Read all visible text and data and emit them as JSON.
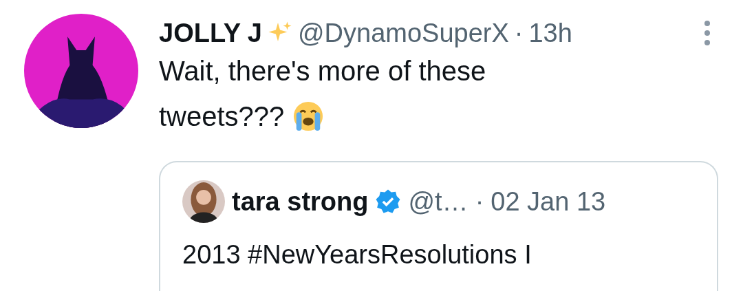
{
  "tweet": {
    "display_name": "JOLLY J",
    "handle": "@DynamoSuperX",
    "separator": "·",
    "time": "13h",
    "text_lines": [
      "Wait, there's more of these",
      "tweets???"
    ],
    "quote": {
      "display_name": "tara strong",
      "verified": true,
      "handle": "@t…",
      "separator": "·",
      "date": "02 Jan 13",
      "text": "2013 #NewYearsResolutions I"
    }
  }
}
